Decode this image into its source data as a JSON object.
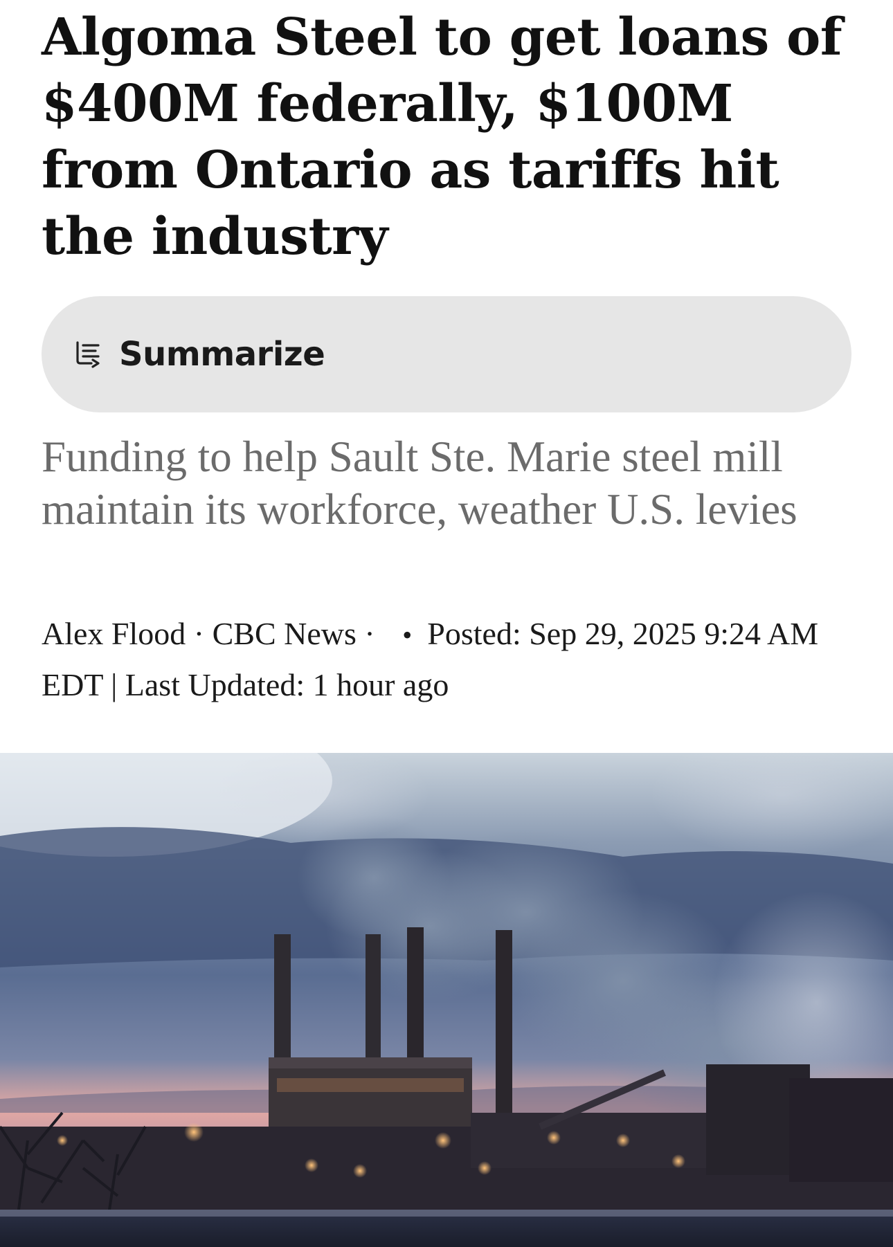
{
  "article": {
    "headline": "Algoma Steel to get loans of $400M federally, $100M from Ontario as tariffs hit the industry",
    "summarize": {
      "label": "Summarize",
      "icon": "summarize-icon"
    },
    "deck": "Funding to help Sault Ste. Marie steel mill maintain its workforce, weather U.S. levies",
    "byline": {
      "author": "Alex Flood",
      "separator": " · ",
      "outlet": "CBC News",
      "outlet_suffix": " · ",
      "bullet": "•",
      "posted": "Posted: Sep 29, 2025 9:24 AM EDT | Last Updated: 1 hour ago"
    },
    "hero_image": {
      "icon": "steel-mill-photo",
      "colors": {
        "sky_top": "#aab8c6",
        "cloud": "#4a5a78",
        "sunset": "#e9a8a0",
        "building": "#2a2a34"
      }
    }
  }
}
